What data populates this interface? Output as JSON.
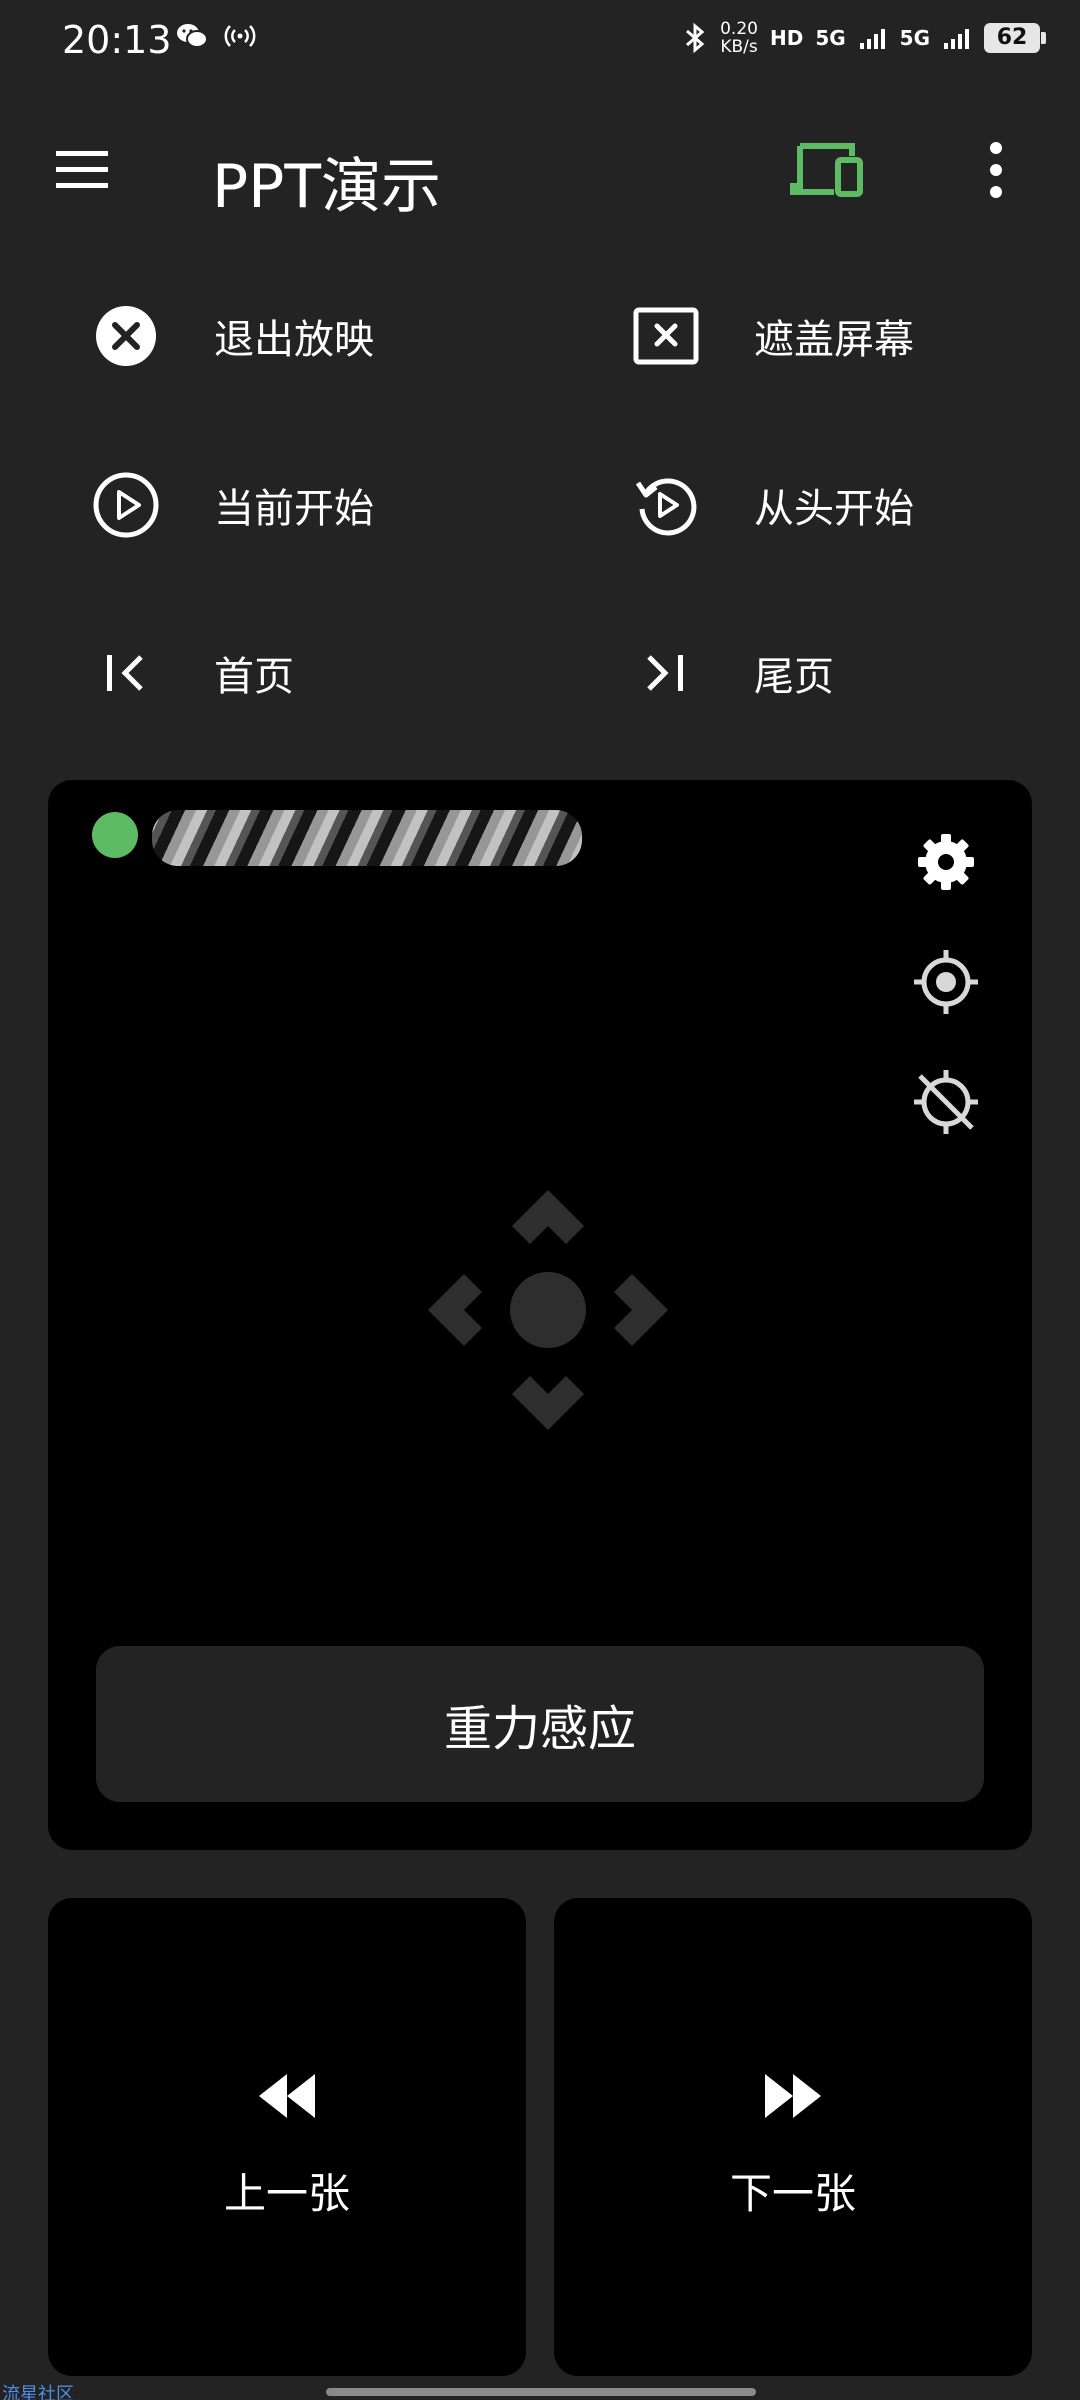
{
  "status_bar": {
    "time": "20:13",
    "left_icons": [
      "wechat-icon",
      "hotspot-icon"
    ],
    "network_rate_value": "0.20",
    "network_rate_unit": "KB/s",
    "hd_label": "HD",
    "sim1_label": "5G",
    "sim2_label": "5G",
    "battery": "62"
  },
  "app_bar": {
    "title": "PPT演示",
    "menu_icon": "hamburger-menu-icon",
    "device_icon": "devices-icon",
    "more_icon": "more-vertical-icon",
    "accent_color": "#5dbb63"
  },
  "actions": [
    {
      "label": "退出放映",
      "icon": "close-circle-icon"
    },
    {
      "label": "遮盖屏幕",
      "icon": "cover-screen-icon"
    },
    {
      "label": "当前开始",
      "icon": "play-circle-icon"
    },
    {
      "label": "从头开始",
      "icon": "restart-icon"
    },
    {
      "label": "首页",
      "icon": "first-page-icon"
    },
    {
      "label": "尾页",
      "icon": "last-page-icon"
    }
  ],
  "touchpad": {
    "status_color": "#5dbb63",
    "device_name": "",
    "side_icons": [
      "settings-icon",
      "gps-fixed-icon",
      "gps-off-icon"
    ],
    "center_icon": "dpad-icon",
    "gravity_label": "重力感应"
  },
  "navigation": {
    "prev_label": "上一张",
    "next_label": "下一张",
    "prev_icon": "rewind-icon",
    "next_icon": "fast-forward-icon"
  },
  "watermark": "流星社区"
}
